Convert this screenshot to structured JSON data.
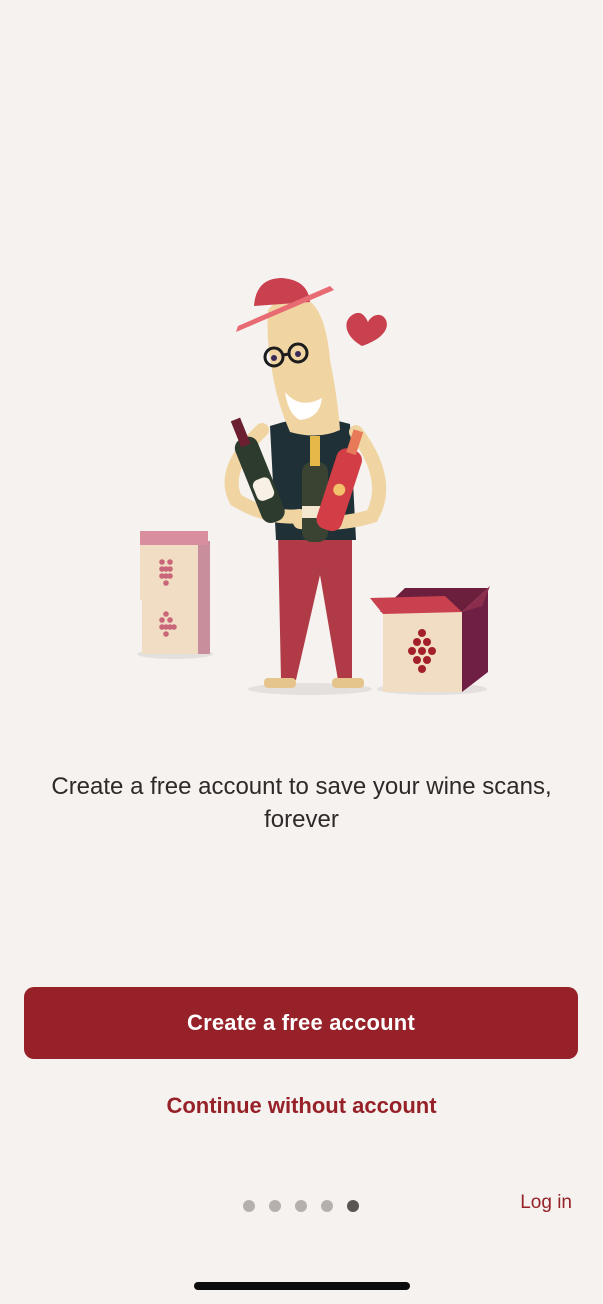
{
  "onboarding": {
    "headline": "Create a free account to save your wine scans, forever",
    "primary_button_label": "Create a free account",
    "secondary_link_label": "Continue without account",
    "login_link_label": "Log in",
    "pager": {
      "total_pages": 5,
      "current_page": 5
    }
  },
  "colors": {
    "background": "#f6f2ef",
    "accent": "#962128",
    "text": "#2e2a29",
    "dot_inactive": "#b5b0ad",
    "dot_active": "#5a5553"
  },
  "illustration": {
    "description_icon": "wine-enthusiast-illustration"
  }
}
